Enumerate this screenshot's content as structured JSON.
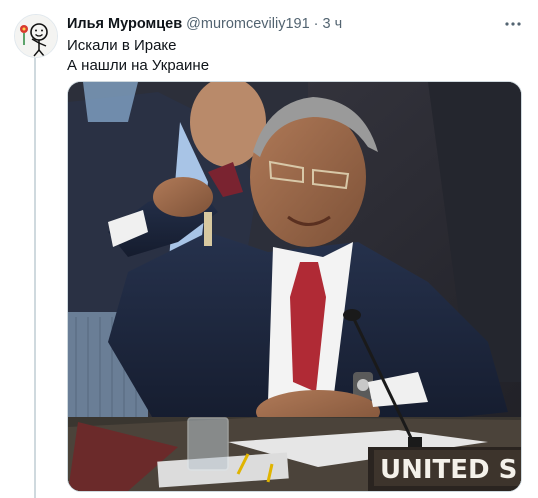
{
  "tweet": {
    "author_name": "Илья Муромцев",
    "author_handle": "@muromceviliy191",
    "separator": "·",
    "time": "3 ч",
    "lines": [
      "Искали в Ираке",
      "А нашли на Украине"
    ],
    "more_icon": "more-horizontal-icon"
  },
  "photo": {
    "nameplate_text": "UNITED S"
  },
  "colors": {
    "text": "#0f1419",
    "secondary": "#536471",
    "thread_line": "#cfd9de"
  }
}
